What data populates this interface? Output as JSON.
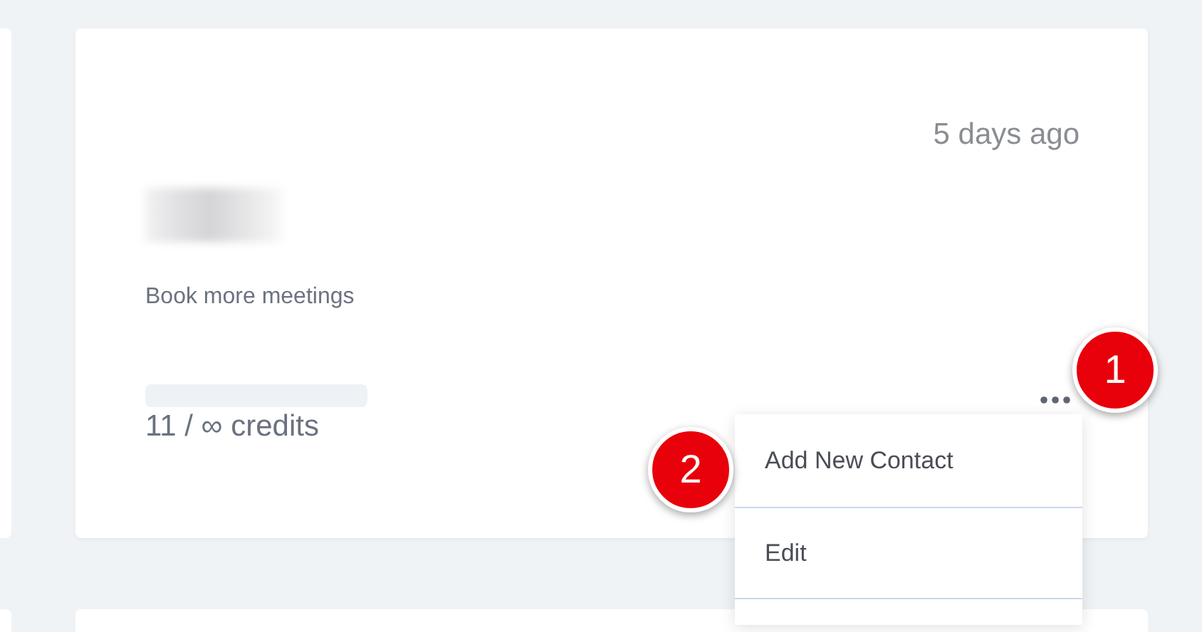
{
  "card": {
    "timestamp": "5 days ago",
    "subtitle": "Book more meetings",
    "credits": {
      "level": 0,
      "label": "11 / ∞ credits"
    }
  },
  "menu": {
    "items": [
      {
        "label": "Add New Contact"
      },
      {
        "label": "Edit"
      }
    ]
  },
  "annotations": [
    {
      "label": "1"
    },
    {
      "label": "2"
    }
  ]
}
